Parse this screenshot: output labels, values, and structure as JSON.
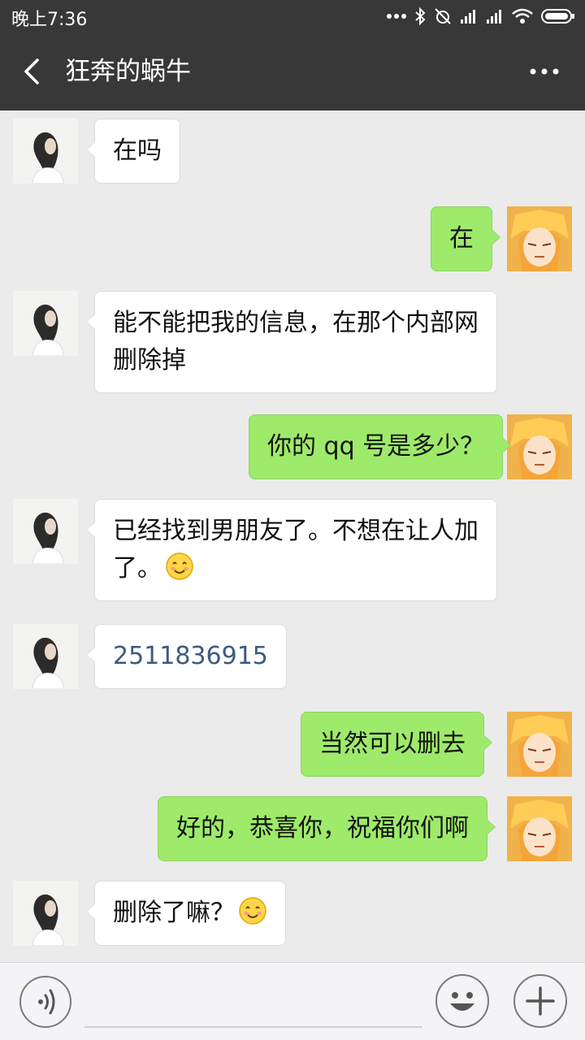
{
  "status_bar": {
    "time": "晚上7:36",
    "icons": [
      "more-dots-icon",
      "bluetooth-icon",
      "alarm-off-icon",
      "signal-icon",
      "signal-icon",
      "wifi-icon",
      "battery-icon"
    ]
  },
  "header": {
    "back_icon": "chevron-left-icon",
    "title": "狂奔的蜗牛",
    "more_icon": "more-horizontal-icon"
  },
  "colors": {
    "bar": "#383838",
    "background": "#ebebeb",
    "sent_bubble": "#9eea6a",
    "received_bubble": "#ffffff"
  },
  "messages": [
    {
      "from": "them",
      "lines": [
        "在吗"
      ]
    },
    {
      "from": "me",
      "lines": [
        "在"
      ]
    },
    {
      "from": "them",
      "lines": [
        "能不能把我的信息，在那个内部网",
        "删除掉"
      ]
    },
    {
      "from": "me",
      "lines": [
        "你的 qq 号是多少？"
      ]
    },
    {
      "from": "them",
      "lines": [
        "已经找到男朋友了。不想在让人加",
        "了。"
      ],
      "emoji": "smile-emoji"
    },
    {
      "from": "them",
      "lines": [
        "2511836915"
      ]
    },
    {
      "from": "me",
      "lines": [
        "当然可以删去"
      ]
    },
    {
      "from": "me",
      "lines": [
        "好的，恭喜你，祝福你们啊"
      ]
    },
    {
      "from": "them",
      "lines": [
        "删除了嘛？"
      ],
      "emoji": "smile-emoji"
    }
  ],
  "input_bar": {
    "voice_icon": "voice-icon",
    "input_value": "",
    "emoji_icon": "emoji-face-icon",
    "plus_icon": "plus-icon"
  }
}
